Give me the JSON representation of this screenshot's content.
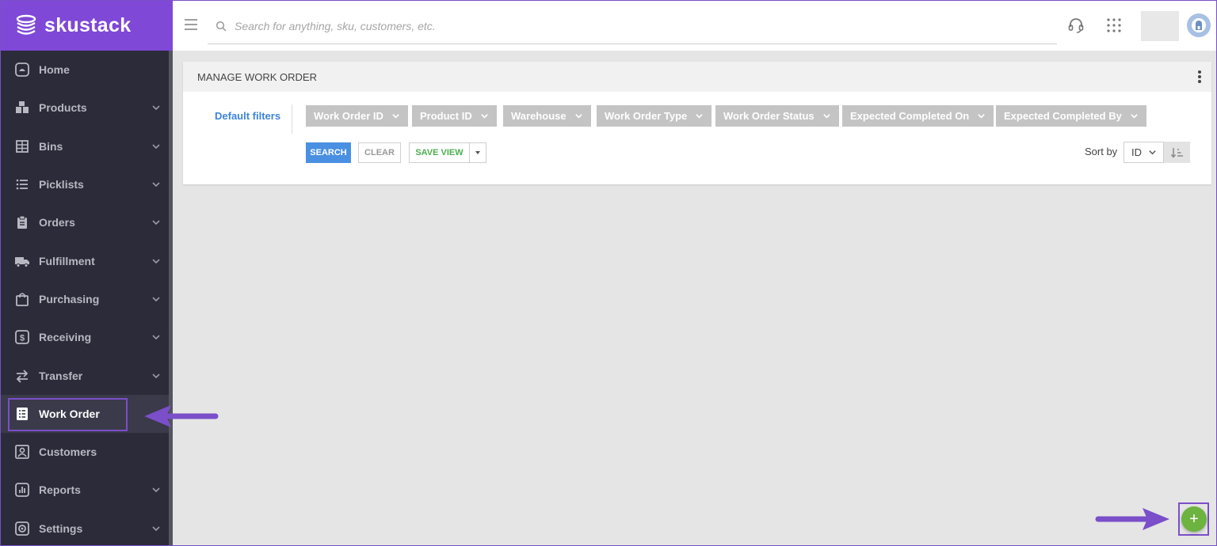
{
  "brand": {
    "name": "skustack"
  },
  "search": {
    "placeholder": "Search for anything, sku, customers, etc."
  },
  "sidebar": {
    "items": [
      {
        "label": "Home",
        "icon": "home-icon",
        "has_chevron": false
      },
      {
        "label": "Products",
        "icon": "products-icon",
        "has_chevron": true
      },
      {
        "label": "Bins",
        "icon": "bins-icon",
        "has_chevron": true
      },
      {
        "label": "Picklists",
        "icon": "list-icon",
        "has_chevron": true
      },
      {
        "label": "Orders",
        "icon": "clipboard-icon",
        "has_chevron": true
      },
      {
        "label": "Fulfillment",
        "icon": "truck-icon",
        "has_chevron": true
      },
      {
        "label": "Purchasing",
        "icon": "bag-icon",
        "has_chevron": true
      },
      {
        "label": "Receiving",
        "icon": "dollar-icon",
        "has_chevron": true
      },
      {
        "label": "Transfer",
        "icon": "transfer-icon",
        "has_chevron": true
      },
      {
        "label": "Work Order",
        "icon": "work-order-icon",
        "has_chevron": false,
        "active": true
      },
      {
        "label": "Customers",
        "icon": "customers-icon",
        "has_chevron": false
      },
      {
        "label": "Reports",
        "icon": "reports-icon",
        "has_chevron": true
      },
      {
        "label": "Settings",
        "icon": "gear-icon",
        "has_chevron": true
      }
    ]
  },
  "card": {
    "title": "MANAGE WORK ORDER",
    "default_filters_label": "Default filters",
    "filters": [
      "Work Order ID",
      "Product ID",
      "Warehouse",
      "Work Order Type",
      "Work Order Status",
      "Expected Completed On",
      "Expected Completed By"
    ],
    "search_label": "SEARCH",
    "clear_label": "CLEAR",
    "save_view_label": "SAVE VIEW",
    "sort_label": "Sort by",
    "sort_value": "ID"
  },
  "fab": {
    "label": "+"
  },
  "colors": {
    "brand": "#7f48d6",
    "sidebar_bg": "#2b2b3a",
    "accent_blue": "#4a90e2",
    "accent_green": "#6db33f",
    "annotation_purple": "#7a4fc9"
  }
}
